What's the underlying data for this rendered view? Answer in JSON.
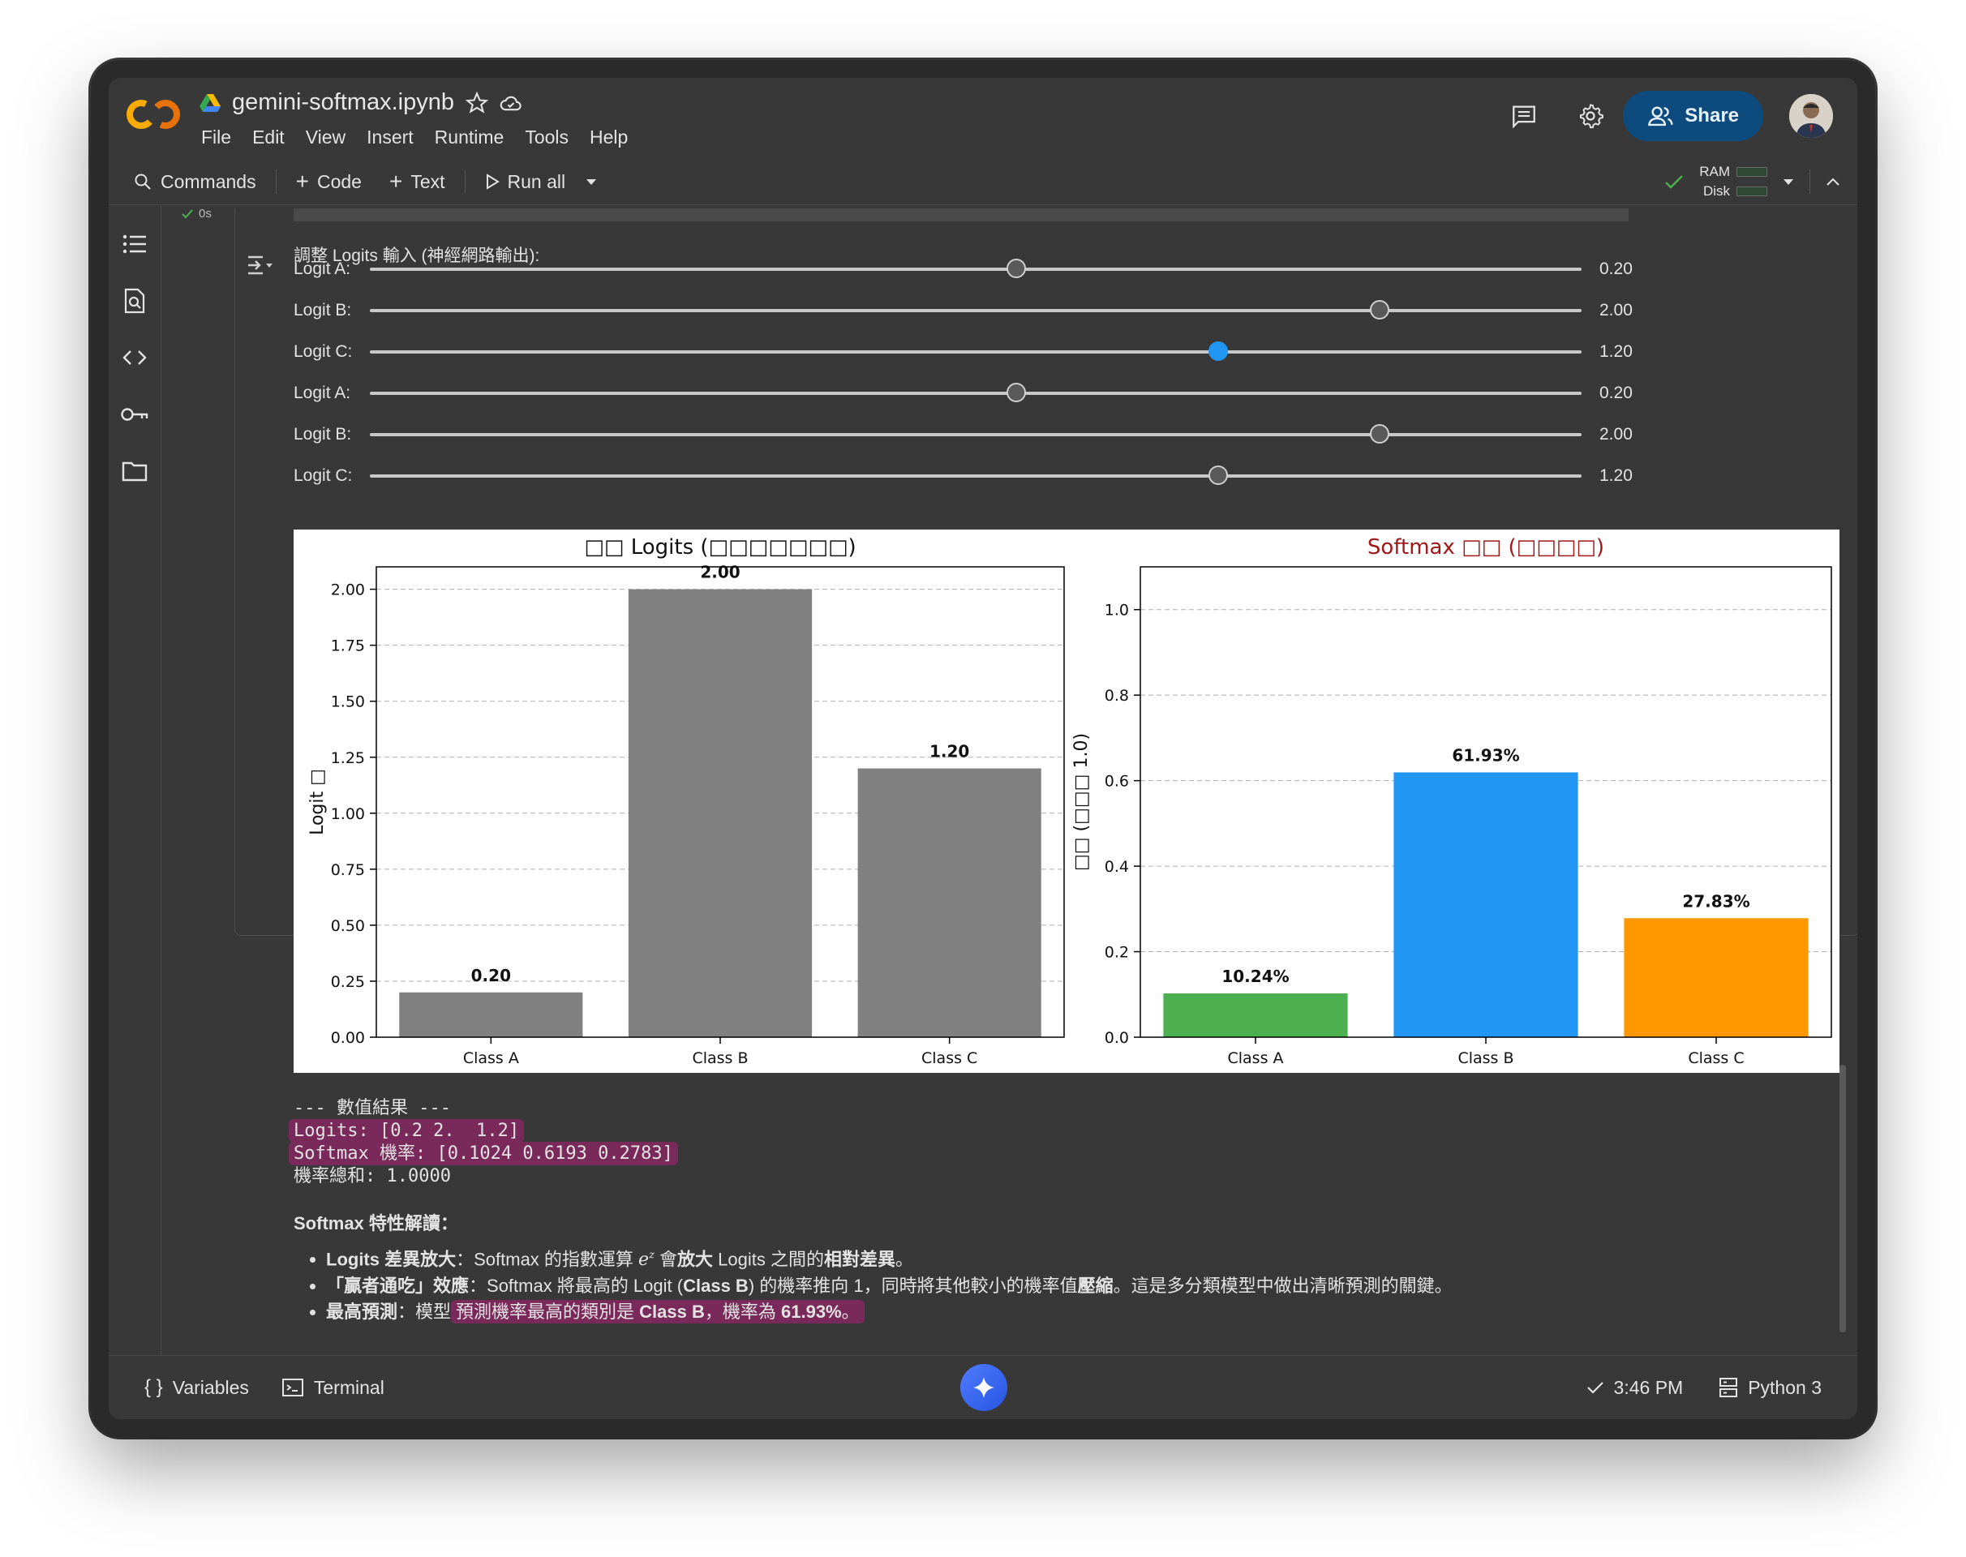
{
  "header": {
    "notebook_title": "gemini-softmax.ipynb",
    "menu": [
      "File",
      "Edit",
      "View",
      "Insert",
      "Runtime",
      "Tools",
      "Help"
    ],
    "share_label": "Share"
  },
  "toolbar": {
    "commands_label": "Commands",
    "code_label": "Code",
    "text_label": "Text",
    "run_all_label": "Run all",
    "ram_label": "RAM",
    "disk_label": "Disk"
  },
  "cell": {
    "exec_time": "0s",
    "sliders_title": "調整 Logits 輸入 (神經網路輸出):",
    "sliders": [
      {
        "label": "Logit A:",
        "value_text": "0.20",
        "value": 0.2,
        "min": -3,
        "max": 3,
        "active": false
      },
      {
        "label": "Logit B:",
        "value_text": "2.00",
        "value": 2.0,
        "min": -3,
        "max": 3,
        "active": false
      },
      {
        "label": "Logit C:",
        "value_text": "1.20",
        "value": 1.2,
        "min": -3,
        "max": 3,
        "active": true
      },
      {
        "label": "Logit A:",
        "value_text": "0.20",
        "value": 0.2,
        "min": -3,
        "max": 3,
        "active": false
      },
      {
        "label": "Logit B:",
        "value_text": "2.00",
        "value": 2.0,
        "min": -3,
        "max": 3,
        "active": false
      },
      {
        "label": "Logit C:",
        "value_text": "1.20",
        "value": 1.2,
        "min": -3,
        "max": 3,
        "active": false
      }
    ]
  },
  "chart_data": [
    {
      "type": "bar",
      "title": "□□ Logits (□□□□□□□)",
      "ylabel": "Logit □",
      "categories": [
        "Class A",
        "Class B",
        "Class C"
      ],
      "values": [
        0.2,
        2.0,
        1.2
      ],
      "data_labels": [
        "0.20",
        "2.00",
        "1.20"
      ],
      "ylim": [
        0,
        2.1
      ],
      "yticks": [
        "0.00",
        "0.25",
        "0.50",
        "0.75",
        "1.00",
        "1.25",
        "1.50",
        "1.75",
        "2.00"
      ],
      "ytick_values": [
        0,
        0.25,
        0.5,
        0.75,
        1.0,
        1.25,
        1.5,
        1.75,
        2.0
      ],
      "colors": [
        "#808080",
        "#808080",
        "#808080"
      ],
      "grid": true
    },
    {
      "type": "bar",
      "title": "Softmax □□ (□□□□)",
      "title_color": "#a01818",
      "ylabel": "□□ (□□□ 1.0)",
      "categories": [
        "Class A",
        "Class B",
        "Class C"
      ],
      "values": [
        0.1024,
        0.6193,
        0.2783
      ],
      "data_labels": [
        "10.24%",
        "61.93%",
        "27.83%"
      ],
      "ylim": [
        0,
        1.1
      ],
      "yticks": [
        "0.0",
        "0.2",
        "0.4",
        "0.6",
        "0.8",
        "1.0"
      ],
      "ytick_values": [
        0,
        0.2,
        0.4,
        0.6,
        0.8,
        1.0
      ],
      "colors": [
        "#4caf50",
        "#2196f3",
        "#ff9800"
      ],
      "grid": true
    }
  ],
  "output": {
    "lines": [
      {
        "text": "--- 數值結果 ---",
        "highlight": false
      },
      {
        "text": "Logits: [0.2 2.  1.2]",
        "highlight": true
      },
      {
        "text": "Softmax 機率: [0.1024 0.6193 0.2783]",
        "highlight": true
      },
      {
        "text": "機率總和: 1.0000",
        "highlight": false
      }
    ]
  },
  "markdown": {
    "heading": "Softmax 特性解讀：",
    "b1_strong": "Logits 差異放大",
    "b1_text1": "：Softmax 的指數運算 ",
    "b1_math": "e^z",
    "b1_text2": " 會",
    "b1_strong2": "放大",
    "b1_text3": " Logits 之間的",
    "b1_strong3": "相對差異",
    "b1_text4": "。",
    "b2_strong": "「贏者通吃」效應",
    "b2_text1": "：Softmax 將最高的 Logit (",
    "b2_strong2": "Class B",
    "b2_text2": ") 的機率推向 1，同時將其他較小的機率值",
    "b2_strong3": "壓縮",
    "b2_text3": "。這是多分類模型中做出清晰預測的關鍵。",
    "b3_strong": "最高預測",
    "b3_text1": "：模型",
    "b3_hl1": "預測機率最高的類別是 ",
    "b3_strong2": "Class B",
    "b3_hl2": "，機率為 ",
    "b3_strong3": "61.93%",
    "b3_hl3": "。"
  },
  "footer": {
    "variables_label": "Variables",
    "terminal_label": "Terminal",
    "time": "3:46 PM",
    "runtime": "Python 3"
  },
  "colors": {
    "share_bg": "#0d4a7e",
    "active_slider": "#2196f3",
    "highlight": "#7a2a5a",
    "logo_orange": "#f9ab00"
  }
}
